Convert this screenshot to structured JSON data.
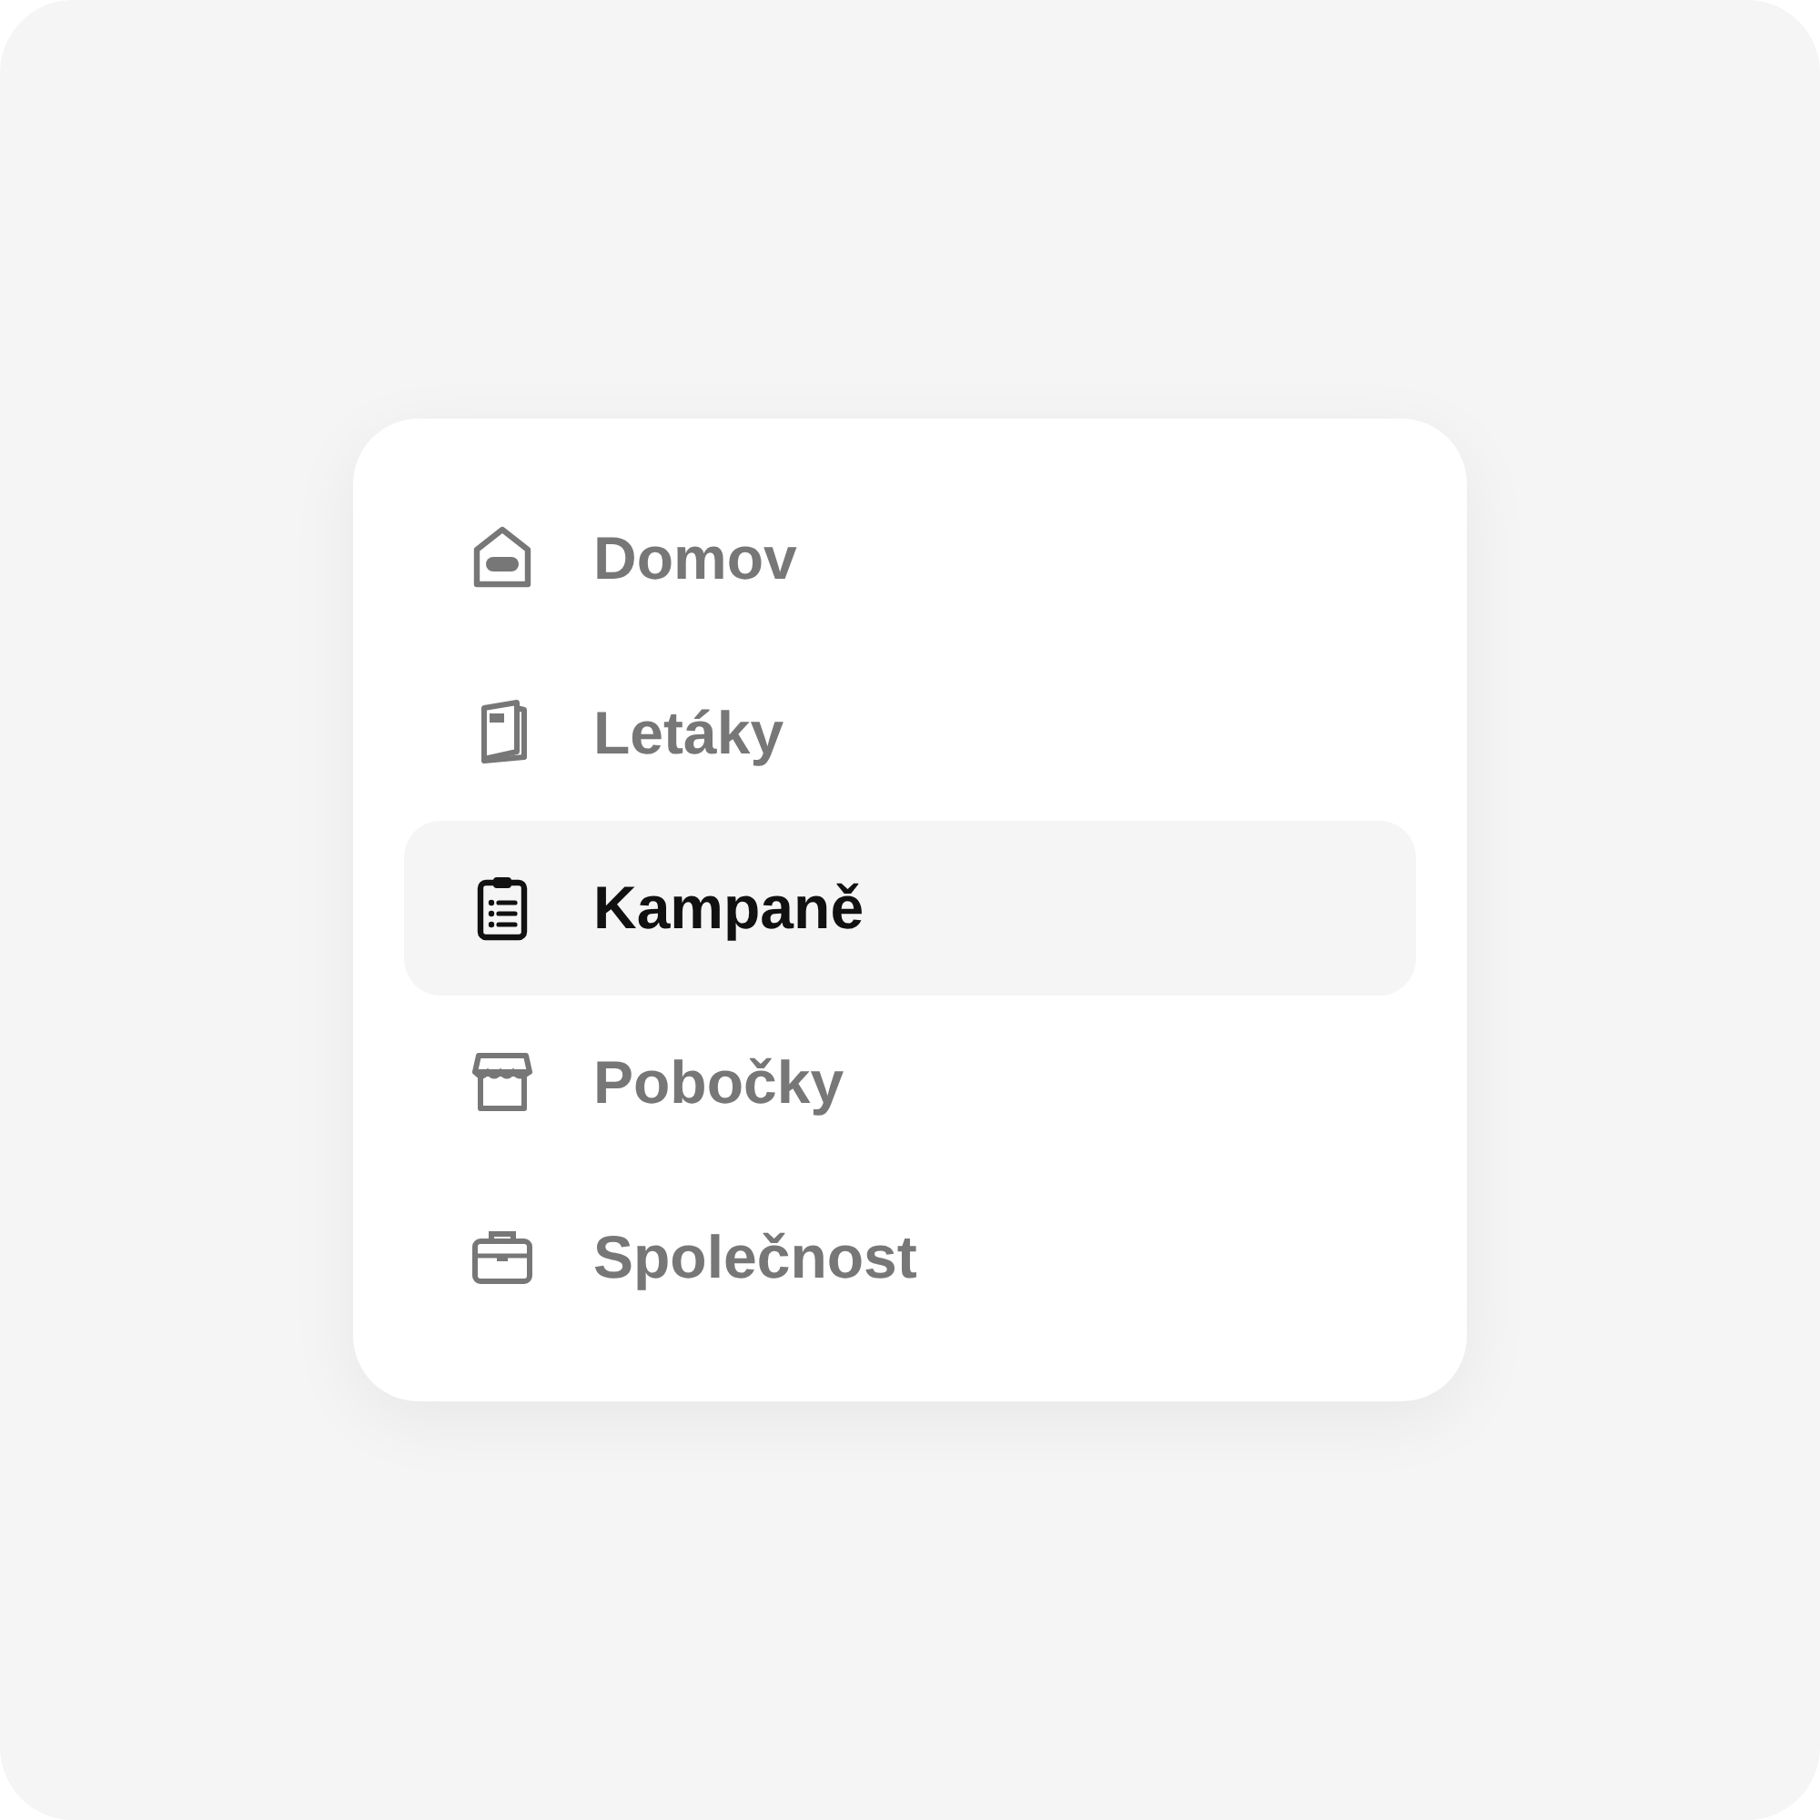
{
  "menu": {
    "items": [
      {
        "kind": "home",
        "label": "Domov",
        "selected": false
      },
      {
        "kind": "leaflet",
        "label": "Letáky",
        "selected": false
      },
      {
        "kind": "clipboard",
        "label": "Kampaně",
        "selected": true
      },
      {
        "kind": "store",
        "label": "Pobočky",
        "selected": false
      },
      {
        "kind": "briefcase",
        "label": "Společnost",
        "selected": false
      }
    ]
  }
}
